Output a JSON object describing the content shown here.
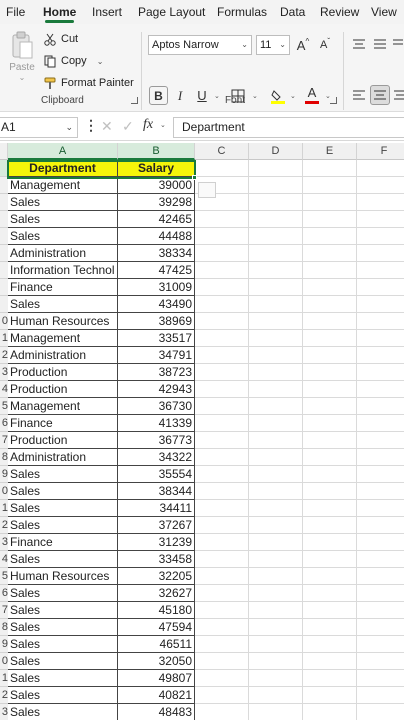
{
  "ribbon_tabs": [
    {
      "label": "File",
      "active": false
    },
    {
      "label": "Home",
      "active": true
    },
    {
      "label": "Insert",
      "active": false
    },
    {
      "label": "Page Layout",
      "active": false
    },
    {
      "label": "Formulas",
      "active": false
    },
    {
      "label": "Data",
      "active": false
    },
    {
      "label": "Review",
      "active": false
    },
    {
      "label": "View",
      "active": false
    }
  ],
  "clipboard": {
    "paste_label": "Paste",
    "cut_label": "Cut",
    "copy_label": "Copy",
    "format_painter_label": "Format Painter",
    "group_label": "Clipboard"
  },
  "font": {
    "font_name": "Aptos Narrow",
    "font_size": "11",
    "group_label": "Font",
    "bold_label": "B",
    "italic_label": "I",
    "underline_label": "U",
    "grow_label": "A",
    "shrink_label": "A",
    "highlight_color": "#ffff00",
    "font_color": "#e00000"
  },
  "formula_bar": {
    "name_box": "A1",
    "fx_label": "fx",
    "content": "Department"
  },
  "columns": [
    "A",
    "B",
    "C",
    "D",
    "E",
    "F"
  ],
  "row_numbers": [
    "",
    "",
    "",
    "",
    "",
    "",
    "",
    "",
    "",
    "0",
    "1",
    "2",
    "3",
    "4",
    "5",
    "6",
    "7",
    "8",
    "9",
    "0",
    "1",
    "2",
    "3",
    "4",
    "5",
    "6",
    "7",
    "8",
    "9",
    "0",
    "1",
    "2",
    "3"
  ],
  "table": {
    "headers": [
      "Department",
      "Salary"
    ],
    "rows": [
      [
        "Management",
        "39000"
      ],
      [
        "Sales",
        "39298"
      ],
      [
        "Sales",
        "42465"
      ],
      [
        "Sales",
        "44488"
      ],
      [
        "Administration",
        "38334"
      ],
      [
        "Information Technol",
        "47425"
      ],
      [
        "Finance",
        "31009"
      ],
      [
        "Sales",
        "43490"
      ],
      [
        "Human Resources",
        "38969"
      ],
      [
        "Management",
        "33517"
      ],
      [
        "Administration",
        "34791"
      ],
      [
        "Production",
        "38723"
      ],
      [
        "Production",
        "42943"
      ],
      [
        "Management",
        "36730"
      ],
      [
        "Finance",
        "41339"
      ],
      [
        "Production",
        "36773"
      ],
      [
        "Administration",
        "34322"
      ],
      [
        "Sales",
        "35554"
      ],
      [
        "Sales",
        "38344"
      ],
      [
        "Sales",
        "34411"
      ],
      [
        "Sales",
        "37267"
      ],
      [
        "Finance",
        "31239"
      ],
      [
        "Sales",
        "33458"
      ],
      [
        "Human Resources",
        "32205"
      ],
      [
        "Sales",
        "32627"
      ],
      [
        "Sales",
        "45180"
      ],
      [
        "Sales",
        "47594"
      ],
      [
        "Sales",
        "46511"
      ],
      [
        "Sales",
        "32050"
      ],
      [
        "Sales",
        "49807"
      ],
      [
        "Sales",
        "40821"
      ],
      [
        "Sales",
        "48483"
      ]
    ]
  },
  "colors": {
    "accent": "#1a7a3c",
    "header_fill": "#f5f50a"
  }
}
